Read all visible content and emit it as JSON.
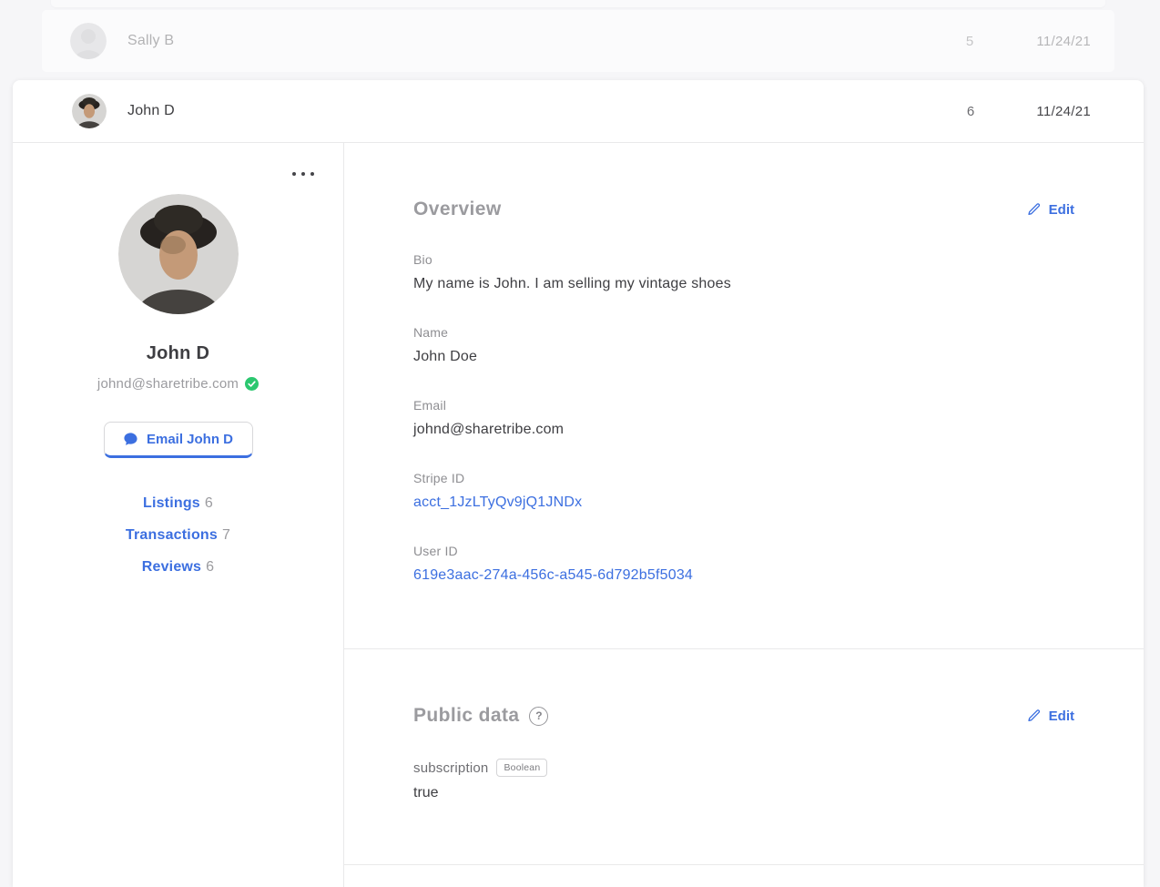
{
  "colors": {
    "accent": "#3c6fe0",
    "green": "#2bc76f",
    "page-bg": "#f6f6f8",
    "divider": "#e9e9ea",
    "text-dark": "#3e3e42",
    "text-gray": "#9b9b9f",
    "label-gray": "#8e8e92"
  },
  "rows": {
    "faded": {
      "name": "Sally B",
      "count": "5",
      "date": "11/24/21"
    },
    "active": {
      "name": "John D",
      "count": "6",
      "date": "11/24/21"
    }
  },
  "profile": {
    "name": "John D",
    "email": "johnd@sharetribe.com",
    "email_button_label": "Email John D",
    "nav": [
      {
        "label": "Listings",
        "count": "6"
      },
      {
        "label": "Transactions",
        "count": "7"
      },
      {
        "label": "Reviews",
        "count": "6"
      }
    ]
  },
  "overview": {
    "title": "Overview",
    "edit_label": "Edit",
    "fields": [
      {
        "label": "Bio",
        "value": "My name is John. I am selling my vintage shoes",
        "type": "text"
      },
      {
        "label": "Name",
        "value": "John Doe",
        "type": "text"
      },
      {
        "label": "Email",
        "value": "johnd@sharetribe.com",
        "type": "text"
      },
      {
        "label": "Stripe ID",
        "value": "acct_1JzLTyQv9jQ1JNDx",
        "type": "link"
      },
      {
        "label": "User ID",
        "value": "619e3aac-274a-456c-a545-6d792b5f5034",
        "type": "link"
      }
    ]
  },
  "public_data": {
    "title": "Public data",
    "edit_label": "Edit",
    "help_glyph": "?",
    "fields": [
      {
        "label": "subscription",
        "badge": "Boolean",
        "value": "true"
      }
    ]
  }
}
